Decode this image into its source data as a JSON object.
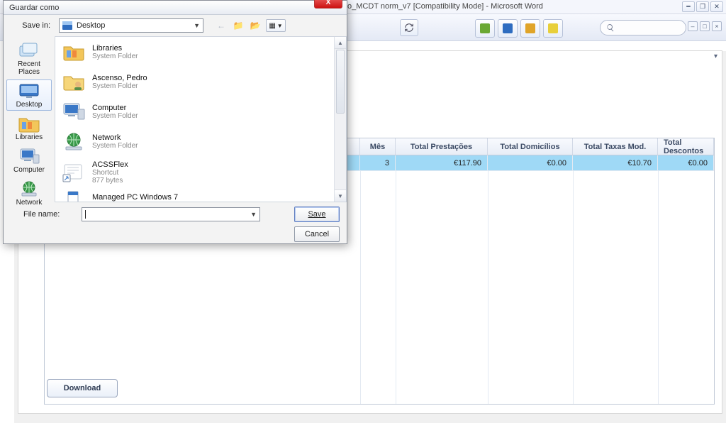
{
  "word": {
    "title": "o_MCDT norm_v7 [Compatibility Mode] - Microsoft Word"
  },
  "page": {
    "download_label": "Download"
  },
  "grid": {
    "headers": [
      "",
      "Mês",
      "Total Prestações",
      "Total Domicílios",
      "Total Taxas Mod.",
      "Total Descontos"
    ],
    "row": [
      "",
      "3",
      "€117.90",
      "€0.00",
      "€10.70",
      "€0.00"
    ]
  },
  "dialog": {
    "title": "Guardar como",
    "save_in_label": "Save in:",
    "save_in_value": "Desktop",
    "filename_label": "File name:",
    "filename_value": "",
    "save_btn": "Save",
    "cancel_btn": "Cancel",
    "places": [
      {
        "label": "Recent Places"
      },
      {
        "label": "Desktop"
      },
      {
        "label": "Libraries"
      },
      {
        "label": "Computer"
      },
      {
        "label": "Network"
      }
    ],
    "files": [
      {
        "name": "Libraries",
        "sub": "System Folder",
        "icon": "libraries"
      },
      {
        "name": "Ascenso, Pedro",
        "sub": "System Folder",
        "icon": "userfolder"
      },
      {
        "name": "Computer",
        "sub": "System Folder",
        "icon": "computer"
      },
      {
        "name": "Network",
        "sub": "System Folder",
        "icon": "network"
      },
      {
        "name": "ACSSFlex",
        "sub": "Shortcut",
        "sub2": "877 bytes",
        "icon": "shortcut"
      },
      {
        "name": "Managed PC Windows 7",
        "sub": "",
        "icon": "doc"
      }
    ]
  }
}
